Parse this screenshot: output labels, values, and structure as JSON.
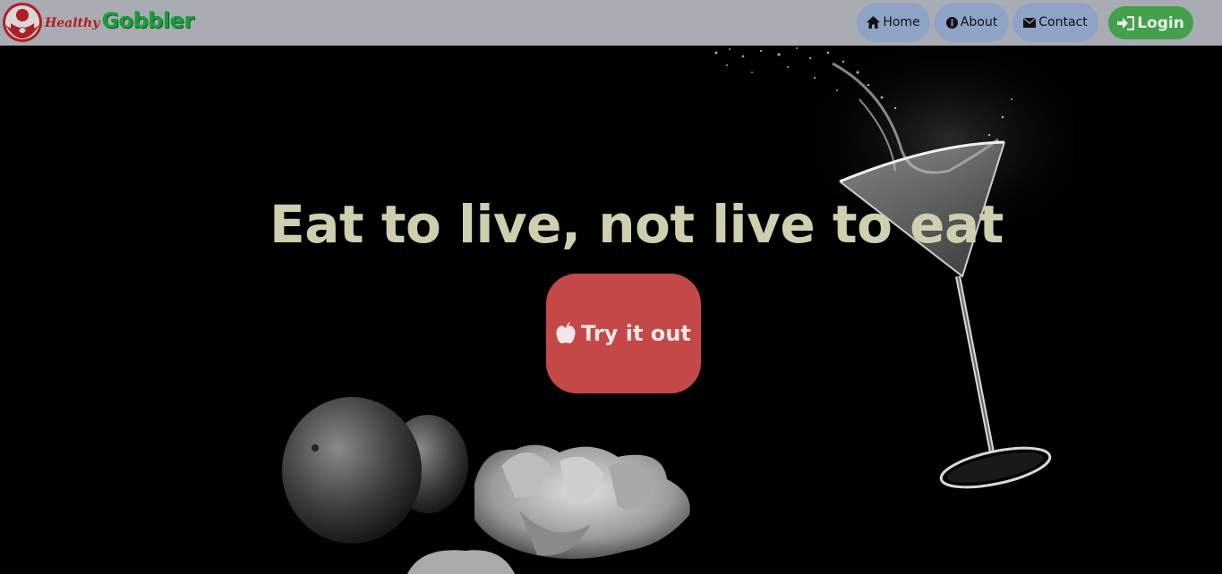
{
  "brand": {
    "healthy": "Healthy",
    "gobbler": "Gobbler",
    "colors": {
      "healthy": "#b31d1d",
      "gobbler": "#1b9d3a"
    }
  },
  "nav": {
    "home": {
      "label": "Home",
      "icon": "home-icon"
    },
    "about": {
      "label": "About",
      "icon": "info-icon"
    },
    "contact": {
      "label": "Contact",
      "icon": "envelope-icon"
    },
    "login": {
      "label": "Login",
      "icon": "login-icon"
    }
  },
  "hero": {
    "headline": "Eat to live, not live to eat",
    "cta_label": "Try it out",
    "cta_icon": "apple-icon"
  },
  "colors": {
    "navbar": "#a9acb3",
    "nav_button": "#8ea3c6",
    "login_button": "#43a04d",
    "cta": "#c44848",
    "headline": "#cfcfb0"
  }
}
